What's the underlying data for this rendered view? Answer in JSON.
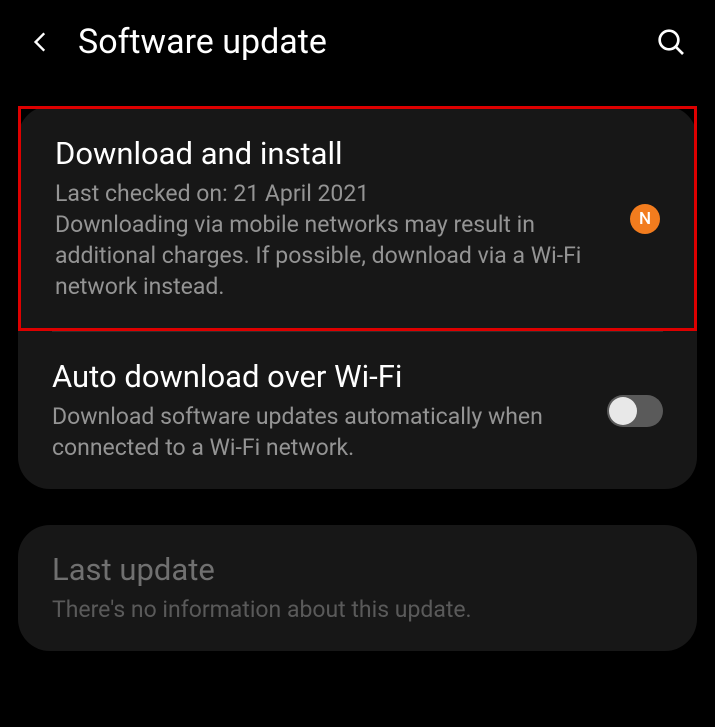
{
  "header": {
    "title": "Software update"
  },
  "items": {
    "download": {
      "title": "Download and install",
      "desc": "Last checked on: 21 April 2021\nDownloading via mobile networks may result in additional charges. If possible, download via a Wi-Fi network instead.",
      "badge": "N"
    },
    "auto": {
      "title": "Auto download over Wi-Fi",
      "desc": "Download software updates automatically when connected to a Wi-Fi network.",
      "toggle": false
    },
    "last": {
      "title": "Last update",
      "desc": "There's no information about this update."
    }
  }
}
